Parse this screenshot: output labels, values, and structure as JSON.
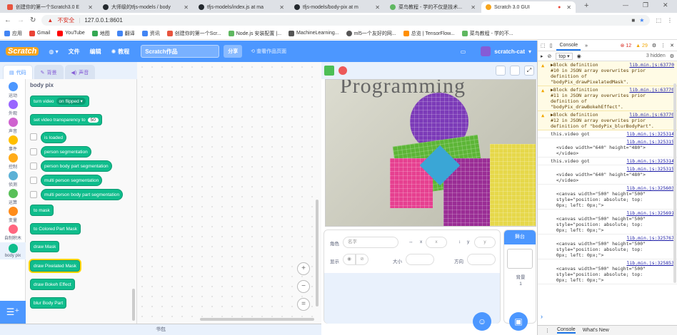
{
  "browser": {
    "tabs": [
      {
        "title": "创建你的第一个Scratch3.0 E",
        "icon_color": "#e8543e"
      },
      {
        "title": "大师级的tfjs-models / body",
        "icon_color": "#24292e"
      },
      {
        "title": "tfjs-models/index.js at ma",
        "icon_color": "#24292e"
      },
      {
        "title": "tfjs-models/body-pix at m",
        "icon_color": "#24292e"
      },
      {
        "title": "菜鸟教程 - 学的不仅是技术...",
        "icon_color": "#5fb760"
      },
      {
        "title": "Scratch 3.0 GUI",
        "icon_color": "#f7a51c"
      }
    ],
    "insecure_label": "不安全",
    "url": "127.0.0.1:8601",
    "bookmarks": [
      {
        "label": "应用",
        "color": "#4285f4"
      },
      {
        "label": "Gmail",
        "color": "#ea4335"
      },
      {
        "label": "YouTube",
        "color": "#ff0000"
      },
      {
        "label": "地图",
        "color": "#34a853"
      },
      {
        "label": "翻译",
        "color": "#4285f4"
      },
      {
        "label": "资讯",
        "color": "#4285f4"
      },
      {
        "label": "创建你的第一个Scr...",
        "color": "#e8543e"
      },
      {
        "label": "Node.js 安装配置 |...",
        "color": "#5fb760"
      },
      {
        "label": "MachineLearning...",
        "color": "#555555"
      },
      {
        "label": "ml5一个友好的网...",
        "color": "#555555"
      },
      {
        "label": "总览 | TensorFlow...",
        "color": "#ff8f00"
      },
      {
        "label": "菜鸟教程 - 学的不...",
        "color": "#5fb760"
      }
    ]
  },
  "menubar": {
    "logo": "Scratch",
    "globe": "",
    "file": "文件",
    "edit": "编辑",
    "tutorials": "教程",
    "project_title": "Scratch作品",
    "share": "分享",
    "see_project": "查看作品页面",
    "username": "scratch-cat"
  },
  "editor_tabs": {
    "code": "代码",
    "costumes": "背景",
    "sounds": "声音"
  },
  "categories": [
    {
      "label": "运动",
      "color": "#4c97ff"
    },
    {
      "label": "外观",
      "color": "#9966ff"
    },
    {
      "label": "声音",
      "color": "#cf63cf"
    },
    {
      "label": "事件",
      "color": "#ffbf00"
    },
    {
      "label": "控制",
      "color": "#ffab19"
    },
    {
      "label": "侦测",
      "color": "#5cb1d6"
    },
    {
      "label": "运算",
      "color": "#59c059"
    },
    {
      "label": "变量",
      "color": "#ff8c1a"
    },
    {
      "label": "自制积木",
      "color": "#ff6680"
    },
    {
      "label": "body pix",
      "color": "#0fbd8c"
    }
  ],
  "palette": {
    "heading": "body pix",
    "turn_video": "turn video",
    "turn_video_opt": "on flipped ▾",
    "set_transparency": "set video transparency to",
    "transparency_val": "50",
    "is_loaded": "is loaded",
    "person_seg": "person segmentation",
    "person_body_part": "person body part segmentation",
    "multi_person": "multi person segmentation",
    "multi_person_body": "multi person body part segmentation",
    "to_mask": "to mask",
    "to_colored": "to Colored Part Mask",
    "draw_mask": "draw Mask",
    "draw_pixelated": "draw Pixelated Mask",
    "draw_bokeh": "draw Bokeh Effect",
    "blur_body": "blur Body Part"
  },
  "footer": "书包",
  "stage": {
    "book_text": "Programming"
  },
  "sprite_info": {
    "sprite_label": "角色",
    "name_placeholder": "名字",
    "x_label": "x",
    "x_value": "x",
    "y_label": "y",
    "y_value": "y",
    "show_label": "显示",
    "size_label": "大小",
    "direction_label": "方向"
  },
  "stage_panel": {
    "header": "舞台",
    "backdrop_label": "背景",
    "backdrop_count": "1"
  },
  "devtools": {
    "tab": "Console",
    "more": "»",
    "errors": "12",
    "warnings": "29",
    "context": "top",
    "hidden": "3 hidden",
    "bottom_tabs": [
      "Console",
      "What's New"
    ],
    "logs": [
      {
        "type": "warn",
        "src": "lib.min.js:63770",
        "text": "▶Block definition\n#10 in JSON array overwrites prior\ndefinition of\n\"bodyPix_drawPixelatedMask\"."
      },
      {
        "type": "warn",
        "src": "lib.min.js:63770",
        "text": "▶Block definition\n#11 in JSON array overwrites prior\ndefinition of\n\"bodyPix_drawBokehEffect\"."
      },
      {
        "type": "warn",
        "src": "lib.min.js:63770",
        "text": "▶Block definition\n#12 in JSON array overwrites prior\ndefinition of \"bodyPix_blurBodyPart\"."
      },
      {
        "type": "log",
        "src": "lib.min.js:325314",
        "text": "this.video got"
      },
      {
        "type": "log",
        "src": "lib.min.js:325315",
        "text": "\n  <video width=\"640\" height=\"480\">\n  </video>"
      },
      {
        "type": "log",
        "src": "lib.min.js:325314",
        "text": "this.video got"
      },
      {
        "type": "log",
        "src": "lib.min.js:325315",
        "text": "\n  <video width=\"640\" height=\"480\">\n  </video>"
      },
      {
        "type": "log",
        "src": "lib.min.js:325603",
        "text": "\n  <canvas width=\"500\" height=\"500\"\n  style=\"position: absolute; top:\n  0px; left: 0px;\">"
      },
      {
        "type": "log",
        "src": "lib.min.js:325691",
        "text": "\n  <canvas width=\"500\" height=\"500\"\n  style=\"position: absolute; top:\n  0px; left: 0px;\">"
      },
      {
        "type": "log",
        "src": "lib.min.js:325767",
        "text": "\n  <canvas width=\"500\" height=\"500\"\n  style=\"position: absolute; top:\n  0px; left: 0px;\">"
      },
      {
        "type": "log",
        "src": "lib.min.js:325853",
        "text": "\n  <canvas width=\"500\" height=\"500\"\n  style=\"position: absolute; top:\n  0px; left: 0px;\">"
      }
    ]
  }
}
